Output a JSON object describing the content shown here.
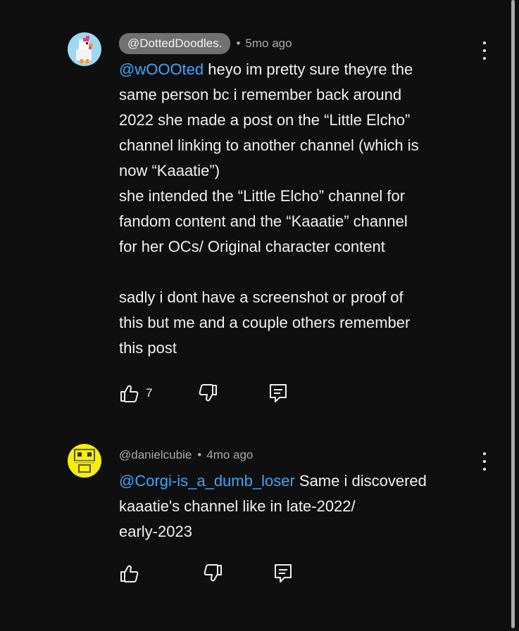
{
  "comments": [
    {
      "author": "@DottedDoodles.",
      "time": "5mo ago",
      "mention": "@wOOOted",
      "lines": [
        " heyo im pretty sure theyre the",
        "same person bc i remember back around",
        "2022 she made a post on the “Little Elcho”",
        "channel linking to another channel (which is",
        "now “Kaaatie”)",
        "she intended the “Little Elcho” channel for",
        "fandom content and the “Kaaatie” channel",
        "for her OCs/ Original character content",
        "",
        "sadly i dont have a screenshot or proof of",
        "this but me and a couple others remember",
        "this post"
      ],
      "like_count": "7",
      "separator": "•"
    },
    {
      "author": "@danielcubie",
      "time": "4mo ago",
      "mention": "@Corgi-is_a_dumb_loser",
      "lines": [
        " Same i discovered",
        "kaaatie's channel like in late-2022/",
        "early-2023"
      ],
      "like_count": "",
      "separator": "•"
    }
  ],
  "icons": {
    "like": "thumbs-up-icon",
    "dislike": "thumbs-down-icon",
    "reply": "reply-icon",
    "menu": "more-vert-icon"
  },
  "colors": {
    "background": "#0f0f0f",
    "mention": "#3ea6ff",
    "secondary_text": "#aaaaaa"
  }
}
